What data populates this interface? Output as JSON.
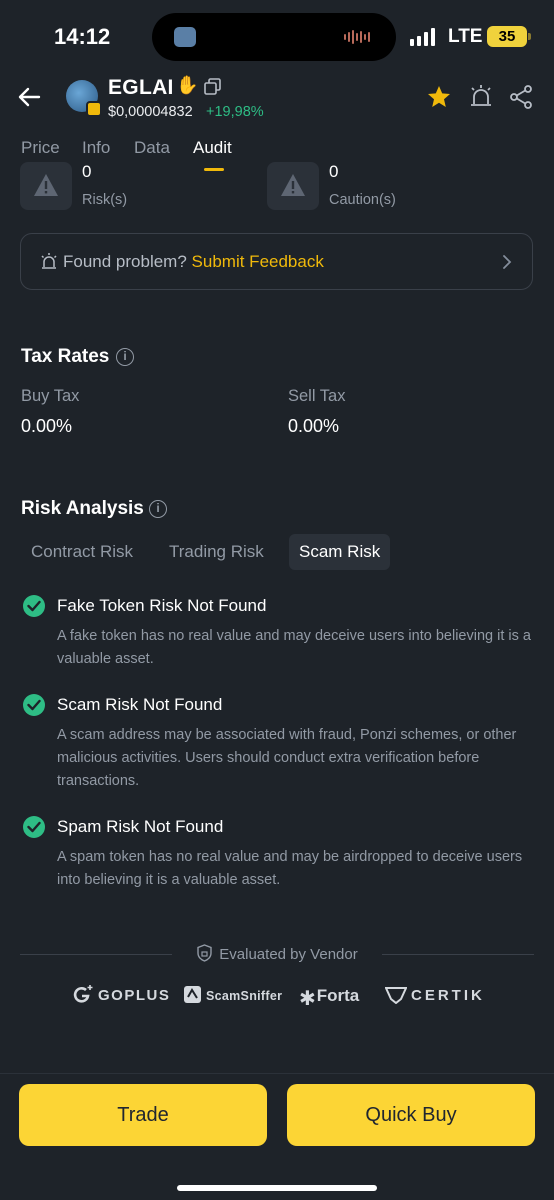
{
  "status_bar": {
    "time": "14:12",
    "network": "LTE",
    "battery": "35"
  },
  "header": {
    "token_name": "EGLAI",
    "price": "$0,00004832",
    "change": "+19,98%",
    "colors": {
      "accent": "#f0b90b",
      "positive": "#2ebd85"
    }
  },
  "tabs": [
    {
      "label": "Price"
    },
    {
      "label": "Info"
    },
    {
      "label": "Data"
    },
    {
      "label": "Audit"
    }
  ],
  "active_tab": "Audit",
  "risk_summary": [
    {
      "count": "0",
      "label": "Risk(s)"
    },
    {
      "count": "0",
      "label": "Caution(s)"
    }
  ],
  "feedback": {
    "prefix": "Found problem?",
    "link": "Submit Feedback"
  },
  "tax_rates": {
    "title": "Tax Rates",
    "buy_label": "Buy Tax",
    "buy_value": "0.00%",
    "sell_label": "Sell Tax",
    "sell_value": "0.00%"
  },
  "risk_analysis": {
    "title": "Risk Analysis",
    "tabs": [
      "Contract Risk",
      "Trading Risk",
      "Scam Risk"
    ],
    "active_tab": "Scam Risk",
    "items": [
      {
        "title": "Fake Token Risk Not Found",
        "desc": "A fake token has no real value and may deceive users into believing it is a valuable asset."
      },
      {
        "title": "Scam Risk Not Found",
        "desc": "A scam address may be associated with fraud, Ponzi schemes, or other malicious activities. Users should conduct extra verification before transactions."
      },
      {
        "title": "Spam Risk Not Found",
        "desc": "A spam token has no real value and may be airdropped to deceive users into believing it is a valuable asset."
      }
    ]
  },
  "vendors": {
    "title": "Evaluated by Vendor",
    "names": [
      "GOPLUS",
      "ScamSniffer",
      "Forta",
      "CERTIK"
    ]
  },
  "actions": {
    "trade": "Trade",
    "quick_buy": "Quick Buy"
  }
}
